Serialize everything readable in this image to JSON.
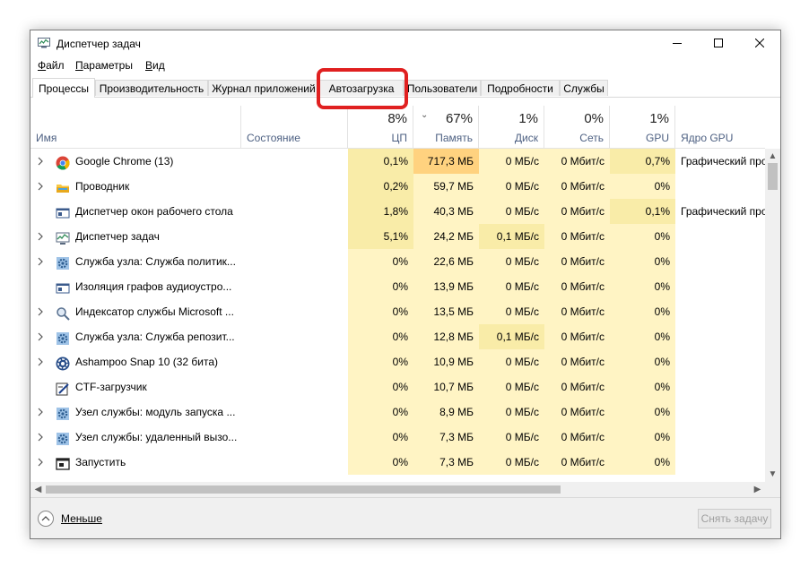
{
  "window": {
    "title": "Диспетчер задач",
    "icon": "task-manager-icon"
  },
  "menu": [
    {
      "label": "Файл",
      "mnemonic": "Ф",
      "rest": "айл"
    },
    {
      "label": "Параметры",
      "mnemonic": "П",
      "rest": "араметры"
    },
    {
      "label": "Вид",
      "mnemonic": "В",
      "rest": "ид"
    }
  ],
  "tabs": [
    {
      "label": "Процессы",
      "active": true
    },
    {
      "label": "Производительность",
      "active": false
    },
    {
      "label": "Журнал приложений",
      "active": false
    },
    {
      "label": "Автозагрузка",
      "active": false,
      "highlighted": true
    },
    {
      "label": "Пользователи",
      "active": false
    },
    {
      "label": "Подробности",
      "active": false
    },
    {
      "label": "Службы",
      "active": false
    }
  ],
  "columns": {
    "name": {
      "label": "Имя"
    },
    "status": {
      "label": "Состояние"
    },
    "cpu": {
      "label": "ЦП",
      "pct": "8%"
    },
    "mem": {
      "label": "Память",
      "pct": "67%",
      "sort_icon": "chevron-down-icon"
    },
    "disk": {
      "label": "Диск",
      "pct": "1%"
    },
    "net": {
      "label": "Сеть",
      "pct": "0%"
    },
    "gpu": {
      "label": "GPU",
      "pct": "1%"
    },
    "gpu_engine": {
      "label": "Ядро GPU"
    }
  },
  "colors": {
    "heat_light": "#fff4c4",
    "heat_medium": "#f9eca8",
    "heat_strong": "#ffd27f",
    "highlight_ring": "#e02020"
  },
  "rows": [
    {
      "name": "Google Chrome (13)",
      "icon": "chrome-icon",
      "expandable": true,
      "cpu": "0,1%",
      "mem": "717,3 МБ",
      "disk": "0 МБ/с",
      "net": "0 Мбит/с",
      "gpu": "0,7%",
      "gpu_engine": "Графический процессор",
      "heat": {
        "cpu": "medium",
        "mem": "strong",
        "disk": "light",
        "net": "light",
        "gpu": "medium"
      }
    },
    {
      "name": "Проводник",
      "icon": "folder-icon",
      "expandable": true,
      "cpu": "0,2%",
      "mem": "59,7 МБ",
      "disk": "0 МБ/с",
      "net": "0 Мбит/с",
      "gpu": "0%",
      "gpu_engine": "",
      "heat": {
        "cpu": "medium",
        "mem": "light",
        "disk": "light",
        "net": "light",
        "gpu": "light"
      }
    },
    {
      "name": "Диспетчер окон рабочего стола",
      "icon": "window-icon",
      "expandable": false,
      "cpu": "1,8%",
      "mem": "40,3 МБ",
      "disk": "0 МБ/с",
      "net": "0 Мбит/с",
      "gpu": "0,1%",
      "gpu_engine": "Графический процессор",
      "heat": {
        "cpu": "medium",
        "mem": "light",
        "disk": "light",
        "net": "light",
        "gpu": "medium"
      }
    },
    {
      "name": "Диспетчер задач",
      "icon": "task-manager-icon",
      "expandable": true,
      "cpu": "5,1%",
      "mem": "24,2 МБ",
      "disk": "0,1 МБ/с",
      "net": "0 Мбит/с",
      "gpu": "0%",
      "gpu_engine": "",
      "heat": {
        "cpu": "medium",
        "mem": "light",
        "disk": "medium",
        "net": "light",
        "gpu": "light"
      }
    },
    {
      "name": "Служба узла: Служба политик...",
      "icon": "gear-icon",
      "expandable": true,
      "cpu": "0%",
      "mem": "22,6 МБ",
      "disk": "0 МБ/с",
      "net": "0 Мбит/с",
      "gpu": "0%",
      "gpu_engine": "",
      "heat": {
        "cpu": "light",
        "mem": "light",
        "disk": "light",
        "net": "light",
        "gpu": "light"
      }
    },
    {
      "name": "Изоляция графов аудиоустро...",
      "icon": "window-icon",
      "expandable": false,
      "cpu": "0%",
      "mem": "13,9 МБ",
      "disk": "0 МБ/с",
      "net": "0 Мбит/с",
      "gpu": "0%",
      "gpu_engine": "",
      "heat": {
        "cpu": "light",
        "mem": "light",
        "disk": "light",
        "net": "light",
        "gpu": "light"
      }
    },
    {
      "name": "Индексатор службы Microsoft ...",
      "icon": "indexer-icon",
      "expandable": true,
      "cpu": "0%",
      "mem": "13,5 МБ",
      "disk": "0 МБ/с",
      "net": "0 Мбит/с",
      "gpu": "0%",
      "gpu_engine": "",
      "heat": {
        "cpu": "light",
        "mem": "light",
        "disk": "light",
        "net": "light",
        "gpu": "light"
      }
    },
    {
      "name": "Служба узла: Служба репозит...",
      "icon": "gear-icon",
      "expandable": true,
      "cpu": "0%",
      "mem": "12,8 МБ",
      "disk": "0,1 МБ/с",
      "net": "0 Мбит/с",
      "gpu": "0%",
      "gpu_engine": "",
      "heat": {
        "cpu": "light",
        "mem": "light",
        "disk": "medium",
        "net": "light",
        "gpu": "light"
      }
    },
    {
      "name": "Ashampoo Snap 10 (32 бита)",
      "icon": "ashampoo-icon",
      "expandable": true,
      "cpu": "0%",
      "mem": "10,9 МБ",
      "disk": "0 МБ/с",
      "net": "0 Мбит/с",
      "gpu": "0%",
      "gpu_engine": "",
      "heat": {
        "cpu": "light",
        "mem": "light",
        "disk": "light",
        "net": "light",
        "gpu": "light"
      }
    },
    {
      "name": "CTF-загрузчик",
      "icon": "pen-icon",
      "expandable": false,
      "cpu": "0%",
      "mem": "10,7 МБ",
      "disk": "0 МБ/с",
      "net": "0 Мбит/с",
      "gpu": "0%",
      "gpu_engine": "",
      "heat": {
        "cpu": "light",
        "mem": "light",
        "disk": "light",
        "net": "light",
        "gpu": "light"
      }
    },
    {
      "name": "Узел службы: модуль запуска ...",
      "icon": "gear-icon",
      "expandable": true,
      "cpu": "0%",
      "mem": "8,9 МБ",
      "disk": "0 МБ/с",
      "net": "0 Мбит/с",
      "gpu": "0%",
      "gpu_engine": "",
      "heat": {
        "cpu": "light",
        "mem": "light",
        "disk": "light",
        "net": "light",
        "gpu": "light"
      }
    },
    {
      "name": "Узел службы: удаленный вызо...",
      "icon": "gear-icon",
      "expandable": true,
      "cpu": "0%",
      "mem": "7,3 МБ",
      "disk": "0 МБ/с",
      "net": "0 Мбит/с",
      "gpu": "0%",
      "gpu_engine": "",
      "heat": {
        "cpu": "light",
        "mem": "light",
        "disk": "light",
        "net": "light",
        "gpu": "light"
      }
    },
    {
      "name": "Запустить",
      "icon": "run-icon",
      "expandable": true,
      "cpu": "0%",
      "mem": "7,3 МБ",
      "disk": "0 МБ/с",
      "net": "0 Мбит/с",
      "gpu": "0%",
      "gpu_engine": "",
      "heat": {
        "cpu": "light",
        "mem": "light",
        "disk": "light",
        "net": "light",
        "gpu": "light"
      }
    }
  ],
  "footer": {
    "less_label": "Меньше",
    "end_task_label": "Снять задачу"
  }
}
